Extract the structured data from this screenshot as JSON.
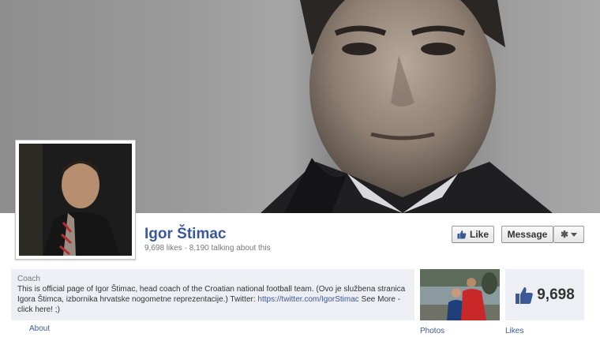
{
  "page": {
    "name": "Igor Štimac",
    "likes_text": "9,698 likes",
    "separator": "·",
    "talking_text": "8,190 talking about this"
  },
  "actions": {
    "like_label": "Like",
    "message_label": "Message",
    "gear_icon": "gear-icon"
  },
  "about": {
    "category": "Coach",
    "description_pre": "This is official page of Igor Štimac, head coach of the Croatian national football team. (Ovo je službena stranica Igora Štimca, izbornika hrvatske nogometne reprezentacije.) Twitter: ",
    "twitter_link": "https://twitter.com/IgorStimac",
    "see_more": " See More - click here! ;)",
    "link_label": "About"
  },
  "tiles": {
    "photos_label": "Photos",
    "likes_label": "Likes",
    "likes_count": "9,698"
  },
  "colors": {
    "brand": "#3b5998",
    "panel": "#edeff4"
  }
}
